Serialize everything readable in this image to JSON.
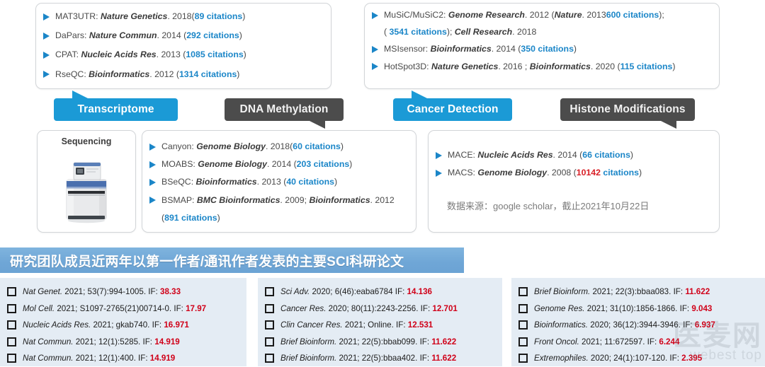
{
  "boxes": {
    "transcriptome_tools": {
      "name": "transcriptome-tools-box",
      "items": [
        {
          "tool": "MAT3UTR:",
          "journal": "Nature Genetics",
          "rest": ". 2018(",
          "cit": "89 citations",
          "tail": ")"
        },
        {
          "tool": "DaPars:",
          "journal": "Nature Commun",
          "rest": ".  2014 (",
          "cit": "292 citations",
          "tail": ")"
        },
        {
          "tool": "CPAT:",
          "journal": "Nucleic Acids Res",
          "rest": ". 2013 (",
          "cit": "1085 citations",
          "tail": ")"
        },
        {
          "tool": "RseQC:",
          "journal": "Bioinformatics",
          "rest": ". 2012 (",
          "cit": "1314 citations",
          "tail": ")"
        }
      ]
    },
    "cancer_tools": {
      "name": "cancer-detection-tools-box",
      "items": [
        {
          "tool": "MuSiC/MuSiC2:",
          "journal": "Genome Research",
          "rest": ". 2012 (",
          "cit": "600 citations",
          "tail": "); ",
          "journal2": "Nature",
          "rest2": ". 2013"
        },
        {
          "cont": true,
          "pre": "( ",
          "cit": "3541 citations",
          "mid": "); ",
          "journal": "Cell Research",
          "rest": ". 2018"
        },
        {
          "tool": "MSIsensor:",
          "journal": "Bioinformatics",
          "rest": ". 2014  (",
          "cit": "350 citations",
          "tail": ")"
        },
        {
          "tool": "HotSpot3D:",
          "journal": "Nature Genetics",
          "rest": ". 2016 ; ",
          "journal2": "Bioinformatics",
          "rest2": ". 2020 (",
          "cit": "115 citations",
          "tail": ")"
        }
      ]
    },
    "methylation_tools": {
      "name": "dna-methylation-tools-box",
      "items": [
        {
          "tool": "Canyon:",
          "journal": "Genome Biology",
          "rest": ". 2018(",
          "cit": "60 citations",
          "tail": ")"
        },
        {
          "tool": "MOABS:",
          "journal": "Genome Biology",
          "rest": ". 2014 (",
          "cit": "203 citations",
          "tail": ")"
        },
        {
          "tool": "BSeQC:",
          "journal": "Bioinformatics",
          "rest": ". 2013 (",
          "cit": "40 citations",
          "tail": ")"
        },
        {
          "tool": "BSMAP:",
          "journal": "BMC Bioinformatics",
          "rest": ". 2009; ",
          "journal2": "Bioinformatics",
          "rest2": ". 2012"
        },
        {
          "cont": true,
          "pre": "(",
          "cit": "891 citations",
          "mid": ")"
        }
      ]
    },
    "histone_tools": {
      "name": "histone-modification-tools-box",
      "items": [
        {
          "tool": "MACE:",
          "journal": "Nucleic Acids Res",
          "rest": ". 2014 (",
          "cit": "66 citations",
          "tail": ")"
        },
        {
          "tool": "MACS:",
          "journal": "Genome Biology",
          "rest": ". 2008  (",
          "cit_red": "10142",
          "cit": " citations",
          "tail": ")"
        }
      ],
      "source_note": "数据来源：google scholar，截止2021年10月22日"
    },
    "sequencing": {
      "name": "sequencing-card",
      "title": "Sequencing"
    }
  },
  "banners": [
    {
      "label": "Transcriptome",
      "color": "#1b9ad6",
      "style": "blue",
      "tail": "up"
    },
    {
      "label": "DNA Methylation",
      "color": "#4c4c4c",
      "style": "gray",
      "tail": "down"
    },
    {
      "label": "Cancer Detection",
      "color": "#1b9ad6",
      "style": "blue",
      "tail": "up"
    },
    {
      "label": "Histone Modifications",
      "color": "#4c4c4c",
      "style": "gray",
      "tail": "down"
    }
  ],
  "sci_section": {
    "header": "研究团队成员近两年以第一作者/通讯作者发表的主要SCI科研论文",
    "header_color": "#6fa6d6",
    "if_color": "#d00018",
    "columns": [
      {
        "name": "publications-column-1",
        "items": [
          {
            "journal": "Nat Genet.",
            "ref": " 2021; 53(7):994-1005. IF: ",
            "if": "38.33"
          },
          {
            "journal": "Mol Cell.",
            "ref": " 2021; S1097-2765(21)00714-0. IF: ",
            "if": "17.97"
          },
          {
            "journal": "Nucleic Acids Res.",
            "ref": " 2021; gkab740. IF: ",
            "if": "16.971"
          },
          {
            "journal": "Nat Commun.",
            "ref": " 2021; 12(1):5285. IF: ",
            "if": "14.919"
          },
          {
            "journal": "Nat Commun.",
            "ref": " 2021; 12(1):400. IF: ",
            "if": "14.919"
          }
        ]
      },
      {
        "name": "publications-column-2",
        "items": [
          {
            "journal": "Sci Adv.",
            "ref": " 2020; 6(46):eaba6784 IF: ",
            "if": "14.136"
          },
          {
            "journal": "Cancer Res.",
            "ref": " 2020; 80(11):2243-2256. IF: ",
            "if": "12.701"
          },
          {
            "journal": "Clin Cancer Res.",
            "ref": " 2021; Online. IF: ",
            "if": "12.531"
          },
          {
            "journal": "Brief Bioinform.",
            "ref": " 2021; 22(5):bbab099. IF: ",
            "if": "11.622"
          },
          {
            "journal": "Brief Bioinform.",
            "ref": " 2021; 22(5):bbaa402.  IF: ",
            "if": "11.622"
          }
        ]
      },
      {
        "name": "publications-column-3",
        "items": [
          {
            "journal": "Brief Bioinform.",
            "ref": " 2021; 22(3):bbaa083. IF: ",
            "if": "11.622"
          },
          {
            "journal": "Genome Res.",
            "ref": " 2021; 31(10):1856-1866. IF: ",
            "if": "9.043"
          },
          {
            "journal": "Bioinformatics.",
            "ref": " 2020; 36(12):3944-3946. IF: ",
            "if": "6.937"
          },
          {
            "journal": "Front Oncol.",
            "ref": " 2021; 11:672597. IF: ",
            "if": "6.244"
          },
          {
            "journal": "Extremophiles.",
            "ref": " 2020; 24(1):107-120. IF: ",
            "if": "2.395"
          }
        ]
      }
    ]
  },
  "watermark": {
    "main": "医麦网",
    "sub": "webest top"
  }
}
